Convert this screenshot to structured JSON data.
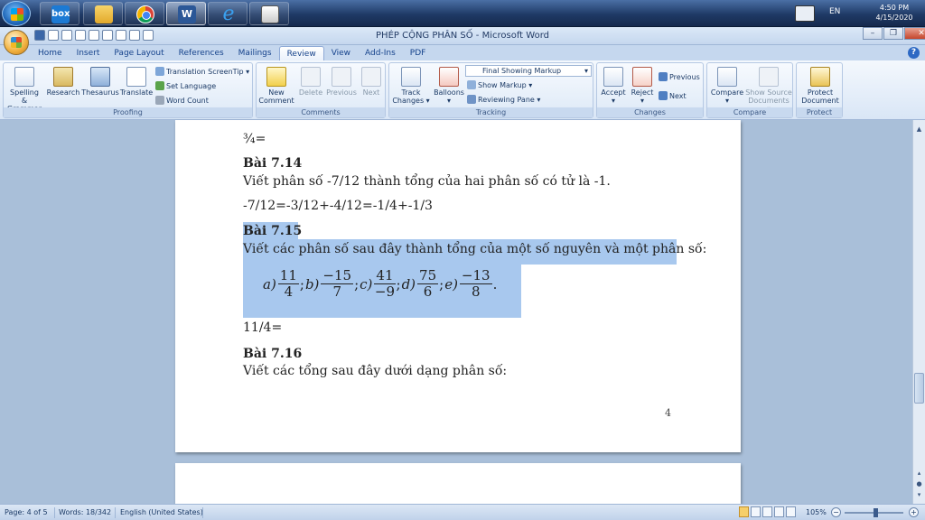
{
  "taskbar": {
    "apps": [
      "box",
      "file-explorer",
      "chrome",
      "word",
      "internet-explorer",
      "printer"
    ],
    "box_label": "box",
    "word_label": "W",
    "ie_label": "e",
    "language": "EN",
    "time": "4:50 PM",
    "date": "4/15/2020"
  },
  "window": {
    "title": "PHÉP CỘNG PHÂN SỐ - Microsoft Word",
    "controls": {
      "minimize": "–",
      "restore": "❐",
      "close": "✕"
    }
  },
  "tabs": [
    "Home",
    "Insert",
    "Page Layout",
    "References",
    "Mailings",
    "Review",
    "View",
    "Add-Ins",
    "PDF"
  ],
  "active_tab": "Review",
  "ribbon": {
    "proofing": {
      "label": "Proofing",
      "spelling": "Spelling & Grammar",
      "spelling_line1": "Spelling &",
      "spelling_line2": "Grammar",
      "research": "Research",
      "thesaurus": "Thesaurus",
      "translate": "Translate",
      "translation_screentip": "Translation ScreenTip",
      "set_language": "Set Language",
      "word_count": "Word Count"
    },
    "comments": {
      "label": "Comments",
      "new_comment_line1": "New",
      "new_comment_line2": "Comment",
      "delete": "Delete",
      "previous": "Previous",
      "next": "Next"
    },
    "tracking": {
      "label": "Tracking",
      "track_changes_line1": "Track",
      "track_changes_line2": "Changes",
      "balloons": "Balloons",
      "markup_select": "Final Showing Markup",
      "show_markup": "Show Markup",
      "reviewing_pane": "Reviewing Pane"
    },
    "changes": {
      "label": "Changes",
      "accept": "Accept",
      "reject": "Reject",
      "previous": "Previous",
      "next": "Next"
    },
    "compare": {
      "label": "Compare",
      "compare": "Compare",
      "show_source_line1": "Show Source",
      "show_source_line2": "Documents"
    },
    "protect": {
      "label": "Protect",
      "protect_line1": "Protect",
      "protect_line2": "Document"
    }
  },
  "document": {
    "line_prev": "¾=",
    "b714_title": "Bài 7.14",
    "b714_text": "Viết phân số -7/12  thành tổng của hai phân số có tử là -1.",
    "b714_answer": "-7/12=-3/12+-4/12=-1/4+-1/3",
    "b715_title": "Bài 7.15",
    "b715_text": "Viết các phân số sau đây thành tổng của một số nguyên và một phân số:",
    "math": {
      "a_label": "a)",
      "a_num": "11",
      "a_den": "4",
      "b_label": "b)",
      "b_num": "−15",
      "b_den": "7",
      "c_label": "c)",
      "c_num": "41",
      "c_den": "−9",
      "d_label": "d)",
      "d_num": "75",
      "d_den": "6",
      "e_label": "e)",
      "e_num": "−13",
      "e_den": "8",
      "sep": ";",
      "end": "."
    },
    "b715_answer": "11/4=",
    "b716_title": "Bài 7.16",
    "b716_text": "Viết các tổng sau đây dưới dạng phân số:",
    "page_number": "4"
  },
  "statusbar": {
    "page": "Page: 4 of 5",
    "words": "Words: 18/342",
    "language": "English (United States)",
    "zoom": "105%"
  },
  "colors": {
    "selection": "#a8c8ee",
    "ribbon_text": "#15428b",
    "workspace": "#a9bfd9"
  }
}
